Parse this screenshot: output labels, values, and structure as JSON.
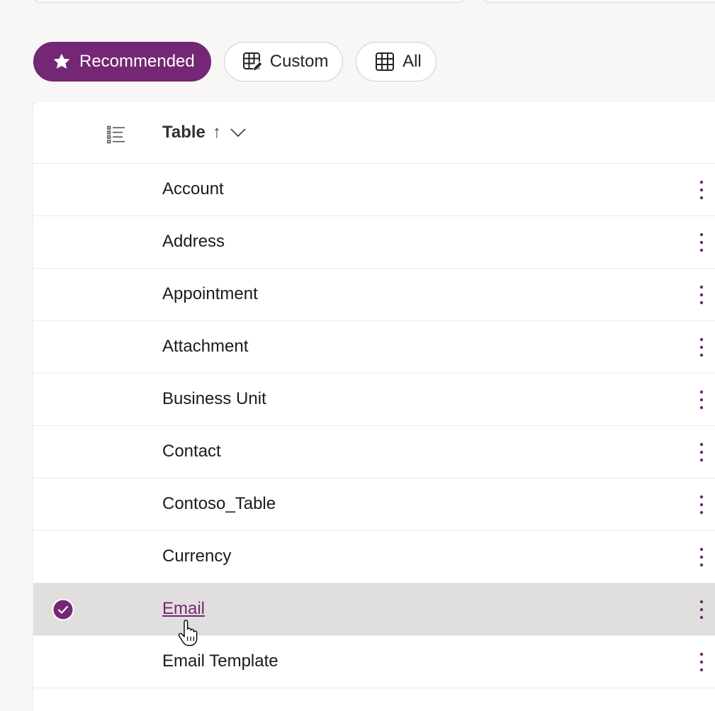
{
  "filters": {
    "recommended": {
      "label": "Recommended",
      "icon": "star-icon"
    },
    "custom": {
      "label": "Custom",
      "icon": "table-edit-icon"
    },
    "all": {
      "label": "All",
      "icon": "table-grid-icon"
    }
  },
  "table": {
    "column_header": "Table",
    "sort_indicator": "↑",
    "rows": [
      {
        "name": "Account"
      },
      {
        "name": "Address"
      },
      {
        "name": "Appointment"
      },
      {
        "name": "Attachment"
      },
      {
        "name": "Business Unit"
      },
      {
        "name": "Contact"
      },
      {
        "name": "Contoso_Table"
      },
      {
        "name": "Currency"
      },
      {
        "name": "Email",
        "selected": true
      },
      {
        "name": "Email Template"
      }
    ]
  },
  "colors": {
    "accent": "#742774",
    "selected_row": "#e1dfdd",
    "background": "#f8f7f6"
  }
}
